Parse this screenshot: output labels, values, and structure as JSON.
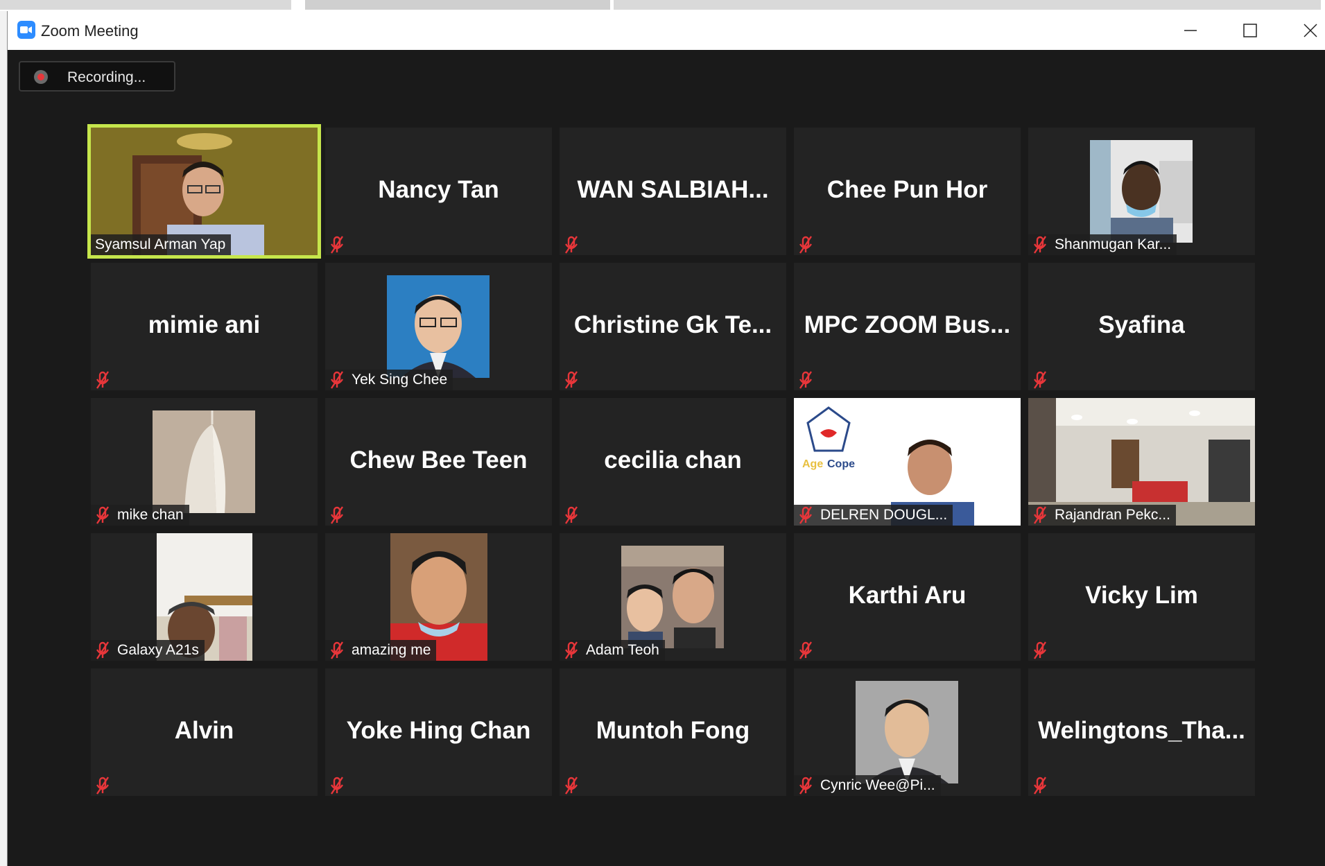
{
  "window": {
    "title": "Zoom Meeting",
    "controls": [
      "minimize-icon",
      "maximize-icon",
      "close-icon"
    ]
  },
  "recording": {
    "label": "Recording..."
  },
  "colors": {
    "active_speaker_border": "#c6e64c",
    "muted_icon": "#e8363a",
    "tile_background": "#232323",
    "meeting_background": "#1a1a1a"
  },
  "participants": [
    {
      "name": "Syamsul Arman Yap",
      "label": "Syamsul Arman Yap",
      "video": "on",
      "active": true
    },
    {
      "name": "Nancy Tan",
      "video": "off"
    },
    {
      "name": "WAN  SALBIAH...",
      "video": "off"
    },
    {
      "name": "Chee Pun Hor",
      "video": "off"
    },
    {
      "name": "Shanmugan Kar...",
      "label": "Shanmugan Kar...",
      "video": "photo"
    },
    {
      "name": "mimie ani",
      "video": "off"
    },
    {
      "name": "Yek Sing Chee",
      "label": "Yek Sing Chee",
      "video": "photo"
    },
    {
      "name": "Christine Gk Te...",
      "video": "off"
    },
    {
      "name": "MPC ZOOM Bus...",
      "video": "off"
    },
    {
      "name": "Syafina",
      "video": "off"
    },
    {
      "name": "mike chan",
      "label": "mike chan",
      "video": "photo"
    },
    {
      "name": "Chew Bee Teen",
      "video": "off"
    },
    {
      "name": "cecilia chan",
      "video": "off"
    },
    {
      "name": "DELREN DOUGL...",
      "label": "DELREN DOUGL...",
      "video": "on",
      "logo_text": "Age Cope"
    },
    {
      "name": "Rajandran Pekc...",
      "label": "Rajandran Pekc...",
      "video": "on"
    },
    {
      "name": "Galaxy A21s",
      "label": "Galaxy A21s",
      "video": "photo"
    },
    {
      "name": "amazing me",
      "label": "amazing me",
      "video": "photo"
    },
    {
      "name": "Adam Teoh",
      "label": "Adam Teoh",
      "video": "photo"
    },
    {
      "name": "Karthi Aru",
      "video": "off"
    },
    {
      "name": "Vicky Lim",
      "video": "off"
    },
    {
      "name": "Alvin",
      "video": "off"
    },
    {
      "name": "Yoke Hing Chan",
      "video": "off"
    },
    {
      "name": "Muntoh Fong",
      "video": "off"
    },
    {
      "name": "Cynric Wee@Pi...",
      "label": "Cynric Wee@Pi...",
      "video": "photo"
    },
    {
      "name": "Welingtons_Tha...",
      "video": "off"
    }
  ]
}
